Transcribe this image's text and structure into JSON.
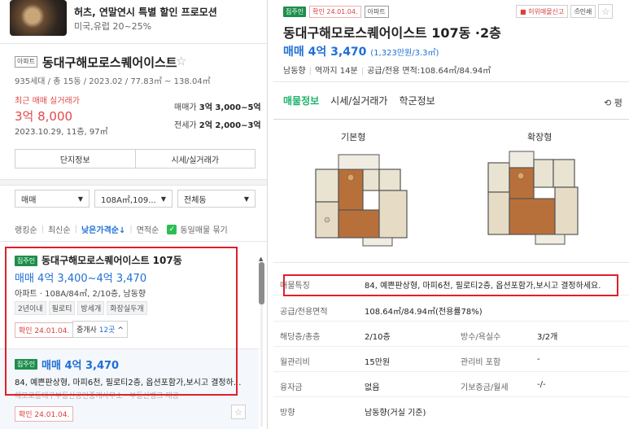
{
  "promo": {
    "title": "허츠, 연말연시 특별 할인 프로모션",
    "subtitle": "미국,유럽 20~25%"
  },
  "complex": {
    "type_tag": "아파트",
    "name": "동대구해모로스퀘어이스트",
    "star": "☆",
    "meta": "935세대 / 총 15동 / 2023.02 / 77.83㎡ ~ 138.04㎡",
    "recent_label": "최근 매매 실거래가",
    "recent_price": "3억 8,000",
    "recent_date": "2023.10.29, 11층, 97㎡",
    "sale_label": "매매가",
    "sale_value": "3억 3,000~5억",
    "rent_label": "전세가",
    "rent_value": "2억 2,000~3억",
    "btn_info": "단지정보",
    "btn_price": "시세/실거래가"
  },
  "filters": {
    "trade": "매매",
    "area": "108A㎡,109...",
    "dong": "전체동"
  },
  "sort": {
    "ranking": "랭킹순",
    "latest": "최신순",
    "low_price": "낮은가격순↓",
    "area": "면적순",
    "same_label": "동일매물 묶기"
  },
  "listing1": {
    "badge": "집주인",
    "name": "동대구해모로스퀘어이스트 107동",
    "price": "매매 4억 3,400~4억 3,470",
    "spec": "아파트 · 108A/84㎡, 2/10층, 남동향",
    "tags": [
      "2년이내",
      "필로티",
      "방세개",
      "화장실두개"
    ],
    "confirm": "확인 24.01.04.",
    "agents_prefix": "중개사",
    "agents_count": "12곳",
    "agents_chev": "^"
  },
  "listing2": {
    "badge": "집주인",
    "price": "매매 4억 3,470",
    "desc": "84, 예쁜판상형, 마피6천, 필로티2층, 옵션포함가,보시고 결정하...",
    "source": "해모로동대구부동산공인중개사무소 · 부동산뱅크 제공",
    "confirm": "확인 24.01.04.",
    "star": "☆"
  },
  "detail": {
    "badge_confirm": "확인 24.01.04.",
    "badge_type": "아파트",
    "act_report": "허위매물신고",
    "act_print": "인쇄",
    "star": "☆",
    "title": "동대구해모로스퀘어이스트 107동 ·2층",
    "price": "매매 4억 3,470",
    "price_per": "(1,323만원/3.3㎡)",
    "meta_dir": "남동향",
    "meta_station": "역까지 14분",
    "meta_area": "공급/전용 면적:108.64㎡/84.94㎡",
    "tabs": [
      "매물정보",
      "시세/실거래가",
      "학군정보"
    ],
    "tab_right": "⟲ 평",
    "plan_basic": "기본형",
    "plan_ext": "확장형"
  },
  "rows": [
    {
      "lab": "매물특징",
      "val": "84, 예쁜판상형, 마피6천, 필로티2층, 옵션포함가,보시고 결정하세요."
    },
    {
      "lab": "공급/전용면적",
      "val": "108.64㎡/84.94㎡(전용률78%)"
    },
    {
      "lab": "해당층/총층",
      "val": "2/10층",
      "lab2": "방수/욕실수",
      "val2": "3/2개"
    },
    {
      "lab": "월관리비",
      "val": "15만원",
      "lab2": "관리비 포함",
      "val2": "-"
    },
    {
      "lab": "융자금",
      "val": "없음",
      "lab2": "기보증금/월세",
      "val2": "-/-"
    },
    {
      "lab": "방향",
      "val": "남동향(거실 기준)"
    }
  ]
}
